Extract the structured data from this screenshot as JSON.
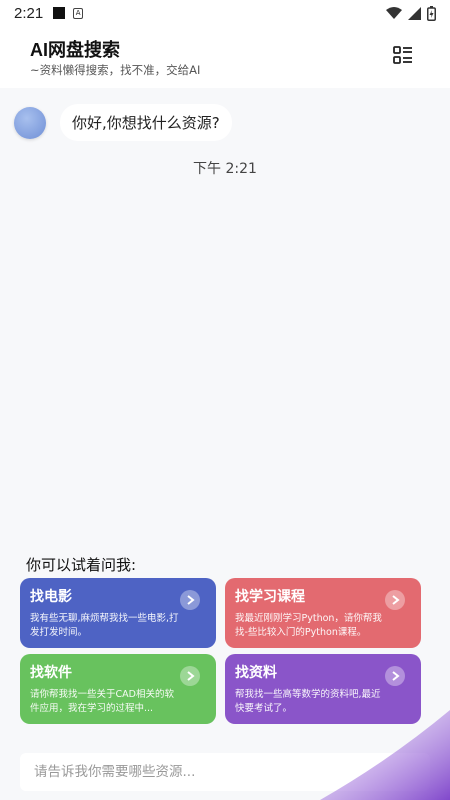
{
  "status_bar": {
    "time": "2:21"
  },
  "header": {
    "title": "AI网盘搜索",
    "subtitle": "~资料懒得搜索，找不准，交给AI"
  },
  "chat": {
    "greeting": "你好,你想找什么资源?",
    "timestamp": "下午 2:21"
  },
  "suggestions": {
    "label": "你可以试着问我:",
    "cards": [
      {
        "title": "找电影",
        "desc": "我有些无聊,麻烦帮我找一些电影,打发打发时间。",
        "color": "#4e63c4"
      },
      {
        "title": "找学习课程",
        "desc": "我最近刚刚学习Python，请你帮我找-些比较入门的Python课程。",
        "color": "#e36a70"
      },
      {
        "title": "找软件",
        "desc": "请你帮我找一些关于CAD相关的软件应用，我在学习的过程中...",
        "color": "#68c25e"
      },
      {
        "title": "找资料",
        "desc": "帮我找一些高等数学的资料吧,最近快要考试了。",
        "color": "#8a55c9"
      }
    ]
  },
  "input": {
    "placeholder": "请告诉我你需要哪些资源..."
  }
}
